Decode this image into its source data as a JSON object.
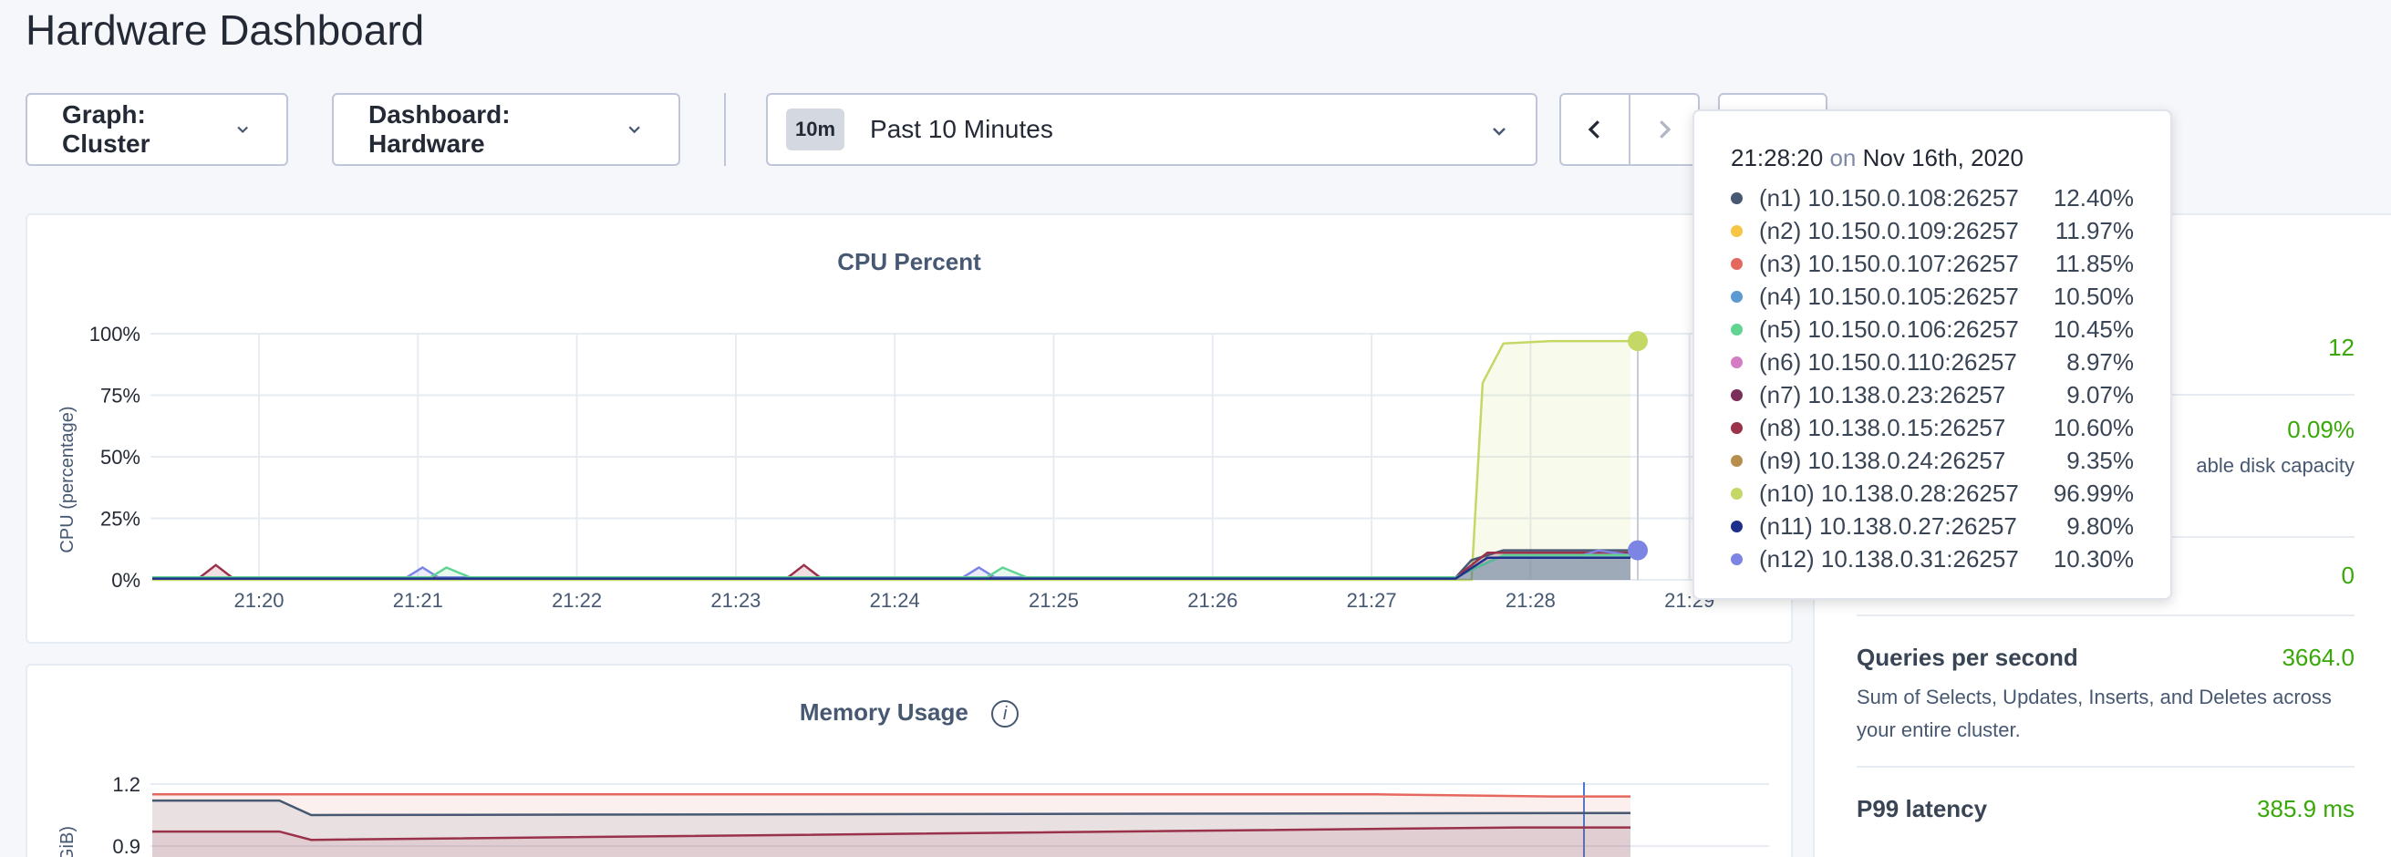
{
  "page": {
    "title": "Hardware Dashboard"
  },
  "toolbar": {
    "graph_label": "Graph: Cluster",
    "dashboard_label": "Dashboard: Hardware",
    "time_badge": "10m",
    "time_label": "Past 10 Minutes"
  },
  "cpu_chart": {
    "title": "CPU Percent",
    "ylabel": "CPU (percentage)"
  },
  "memory_chart": {
    "title": "Memory Usage",
    "info": "i",
    "ylabel": "GiB)"
  },
  "summary": {
    "capacity_value": "12",
    "capacity_desc_partial": "able disk capacity",
    "disk_value": "0.09%",
    "unavail_value": "0",
    "qps": {
      "name": "Queries per second",
      "value": "3664.0",
      "desc": "Sum of Selects, Updates, Inserts, and Deletes across your entire cluster."
    },
    "p99": {
      "name": "P99 latency",
      "value": "385.9 ms"
    }
  },
  "tooltip": {
    "time": "21:28:20",
    "on": "on",
    "date": "Nov 16th, 2020",
    "rows": [
      {
        "label": "(n1) 10.150.0.108:26257",
        "value": "12.40%",
        "color": "#475872"
      },
      {
        "label": "(n2) 10.150.0.109:26257",
        "value": "11.97%",
        "color": "#f6c544"
      },
      {
        "label": "(n3) 10.150.0.107:26257",
        "value": "11.85%",
        "color": "#e5685e"
      },
      {
        "label": "(n4) 10.150.0.105:26257",
        "value": "10.50%",
        "color": "#5c9bd1"
      },
      {
        "label": "(n5) 10.150.0.106:26257",
        "value": "10.45%",
        "color": "#61d494"
      },
      {
        "label": "(n6) 10.150.0.110:26257",
        "value": "8.97%",
        "color": "#d47dc4"
      },
      {
        "label": "(n7) 10.138.0.23:26257",
        "value": "9.07%",
        "color": "#7a2e59"
      },
      {
        "label": "(n8) 10.138.0.15:26257",
        "value": "10.60%",
        "color": "#99324a"
      },
      {
        "label": "(n9) 10.138.0.24:26257",
        "value": "9.35%",
        "color": "#b88e4e"
      },
      {
        "label": "(n10) 10.138.0.28:26257",
        "value": "96.99%",
        "color": "#c4d866"
      },
      {
        "label": "(n11) 10.138.0.27:26257",
        "value": "9.80%",
        "color": "#1f2f8c"
      },
      {
        "label": "(n12) 10.138.0.31:26257",
        "value": "10.30%",
        "color": "#7c85e3"
      }
    ]
  },
  "chart_data": [
    {
      "type": "area",
      "title": "CPU Percent",
      "ylabel": "CPU (percentage)",
      "yticks": [
        "100%",
        "75%",
        "50%",
        "25%",
        "0%"
      ],
      "xticks": [
        "21:20",
        "21:21",
        "21:22",
        "21:23",
        "21:24",
        "21:25",
        "21:26",
        "21:27",
        "21:28",
        "21:29"
      ],
      "ylim": [
        0,
        100
      ],
      "grid": true,
      "series": [
        {
          "name": "(n10) 10.138.0.28:26257",
          "color": "#c4d866",
          "points": [
            [
              0,
              0
            ],
            [
              8.3,
              0
            ],
            [
              8.37,
              80
            ],
            [
              8.5,
              96
            ],
            [
              8.8,
              97
            ],
            [
              9.1,
              97
            ],
            [
              9.3,
              97
            ]
          ]
        },
        {
          "name": "(n1) 10.150.0.108:26257",
          "color": "#475872",
          "points": [
            [
              0,
              1
            ],
            [
              8.2,
              1
            ],
            [
              8.3,
              8
            ],
            [
              8.5,
              12
            ],
            [
              9.0,
              12
            ],
            [
              9.3,
              12
            ]
          ]
        },
        {
          "name": "(n8) 10.138.0.15:26257",
          "color": "#99324a",
          "points": [
            [
              0,
              1
            ],
            [
              0.3,
              1
            ],
            [
              0.4,
              6
            ],
            [
              0.5,
              1
            ],
            [
              4.0,
              1
            ],
            [
              4.1,
              6
            ],
            [
              4.2,
              1
            ],
            [
              8.2,
              1
            ],
            [
              8.4,
              11
            ],
            [
              9.3,
              11
            ]
          ]
        },
        {
          "name": "(n12) 10.138.0.31:26257",
          "color": "#7c85e3",
          "points": [
            [
              0,
              1
            ],
            [
              1.6,
              1
            ],
            [
              1.7,
              5
            ],
            [
              1.8,
              1
            ],
            [
              5.1,
              1
            ],
            [
              5.2,
              5
            ],
            [
              5.3,
              1
            ],
            [
              8.2,
              1
            ],
            [
              8.5,
              10
            ],
            [
              9.0,
              10
            ],
            [
              9.1,
              12
            ],
            [
              9.3,
              10
            ]
          ]
        },
        {
          "name": "(n5) 10.150.0.106:26257",
          "color": "#61d494",
          "points": [
            [
              0,
              1
            ],
            [
              1.75,
              1
            ],
            [
              1.85,
              5
            ],
            [
              2.0,
              1
            ],
            [
              5.25,
              1
            ],
            [
              5.35,
              5
            ],
            [
              5.5,
              1
            ],
            [
              8.2,
              1
            ],
            [
              8.5,
              10
            ],
            [
              9.3,
              10
            ]
          ]
        },
        {
          "name": "(n11) 10.138.0.27:26257",
          "color": "#1f2f8c",
          "points": [
            [
              0,
              0.5
            ],
            [
              8.2,
              0.5
            ],
            [
              8.4,
              9
            ],
            [
              9.3,
              9
            ]
          ]
        }
      ]
    },
    {
      "type": "area",
      "title": "Memory Usage",
      "yticks": [
        "1.2",
        "0.9"
      ],
      "series": [
        {
          "color": "#e5685e",
          "points": [
            [
              0,
              1.15
            ],
            [
              7.7,
              1.15
            ],
            [
              8.8,
              1.14
            ],
            [
              9.3,
              1.14
            ]
          ]
        },
        {
          "color": "#475872",
          "points": [
            [
              0,
              1.12
            ],
            [
              0.8,
              1.12
            ],
            [
              1.0,
              1.05
            ],
            [
              9.3,
              1.06
            ]
          ]
        },
        {
          "color": "#99324a",
          "points": [
            [
              0,
              0.97
            ],
            [
              0.8,
              0.97
            ],
            [
              1.0,
              0.93
            ],
            [
              8.6,
              0.99
            ],
            [
              9.3,
              0.99
            ]
          ]
        }
      ]
    }
  ]
}
